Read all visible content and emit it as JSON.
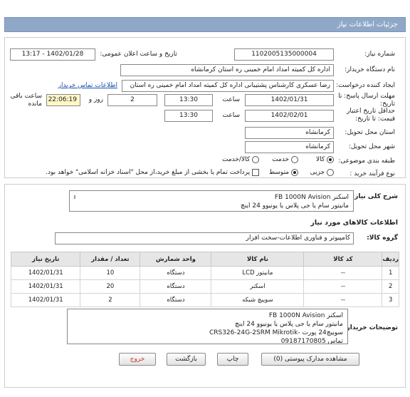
{
  "header": {
    "title": "جزئیات اطلاعات نیاز"
  },
  "form": {
    "need_number_label": "شماره نیاز:",
    "need_number": "1102005135000004",
    "announce_label": "تاریخ و ساعت اعلان عمومی:",
    "announce_value": "1402/01/28 - 13:17",
    "buyer_org_label": "نام دستگاه خریدار:",
    "buyer_org": "اداره کل کمیته امداد امام خمینی  ره  استان کرمانشاه",
    "requester_label": "ایجاد کننده درخواست:",
    "requester": "رضا عسکری کارشناس پشتیبانی اداره کل کمیته امداد امام خمینی  ره  استان",
    "contact_link": "اطلاعات تماس خریدار",
    "deadline_label": "مهلت ارسال پاسخ: تا تاریخ:",
    "deadline_date": "1402/01/31",
    "time_label": "ساعت",
    "deadline_time": "13:30",
    "days_value": "2",
    "days_label": "روز و",
    "remaining_time": "22:06:19",
    "remaining_label": "ساعت باقی مانده",
    "validity_label": "حداقل تاریخ اعتبار قیمت: تا تاریخ:",
    "validity_date": "1402/02/01",
    "validity_time_label": "ساعت",
    "validity_time": "13:30",
    "province_label": "استان محل تحویل:",
    "province": "کرمانشاه",
    "city_label": "شهر محل تحویل:",
    "city": "کرمانشاه",
    "category_label": "طبقه بندی موضوعی:",
    "category_options": [
      "کالا",
      "خدمت",
      "کالا/خدمت"
    ],
    "process_label": "نوع فرآیند خرید :",
    "process_options": [
      "جزیی",
      "متوسط"
    ],
    "payment_note": "پرداخت تمام یا بخشی از مبلغ خرید،از محل \"اسناد خزانه اسلامی\" خواهد بود."
  },
  "details": {
    "summary_label": "شرح کلی نیاز:",
    "summary_lines": [
      "اسکنر  FB 1000N  Avision",
      "مانیتور سام یا جی پلاس یا یونیوو  24  اینچ"
    ],
    "goods_info_title": "اطلاعات کالاهای مورد نیاز",
    "goods_group_label": "گروه کالا:",
    "goods_group": "کامپیوتر و فناوری اطلاعات-سخت افزار",
    "table_headers": [
      "ردیف",
      "کد کالا",
      "نام کالا",
      "واحد شمارش",
      "تعداد / مقدار",
      "تاریخ نیاز"
    ],
    "rows": [
      [
        "1",
        "--",
        "مانیتور LCD",
        "دستگاه",
        "10",
        "1402/01/31"
      ],
      [
        "2",
        "--",
        "اسکنر",
        "دستگاه",
        "20",
        "1402/01/31"
      ],
      [
        "3",
        "--",
        "سوییچ شبکه",
        "دستگاه",
        "2",
        "1402/01/31"
      ]
    ],
    "buyer_notes_label": "توضیحات خریدار:",
    "buyer_notes_lines": [
      "اسکنر  FB 1000N  Avision",
      "مانیتور سام یا جی پلاس یا یونیوو  24  اینچ",
      "سوییچ24 پورت  -CRS326-24G-2SRM  Mikrotik",
      "تماس 09187170805"
    ]
  },
  "buttons": {
    "view_docs": "مشاهده مدارک پیوستی (0)",
    "print": "چاپ",
    "back": "بازگشت",
    "exit": "خروج"
  }
}
